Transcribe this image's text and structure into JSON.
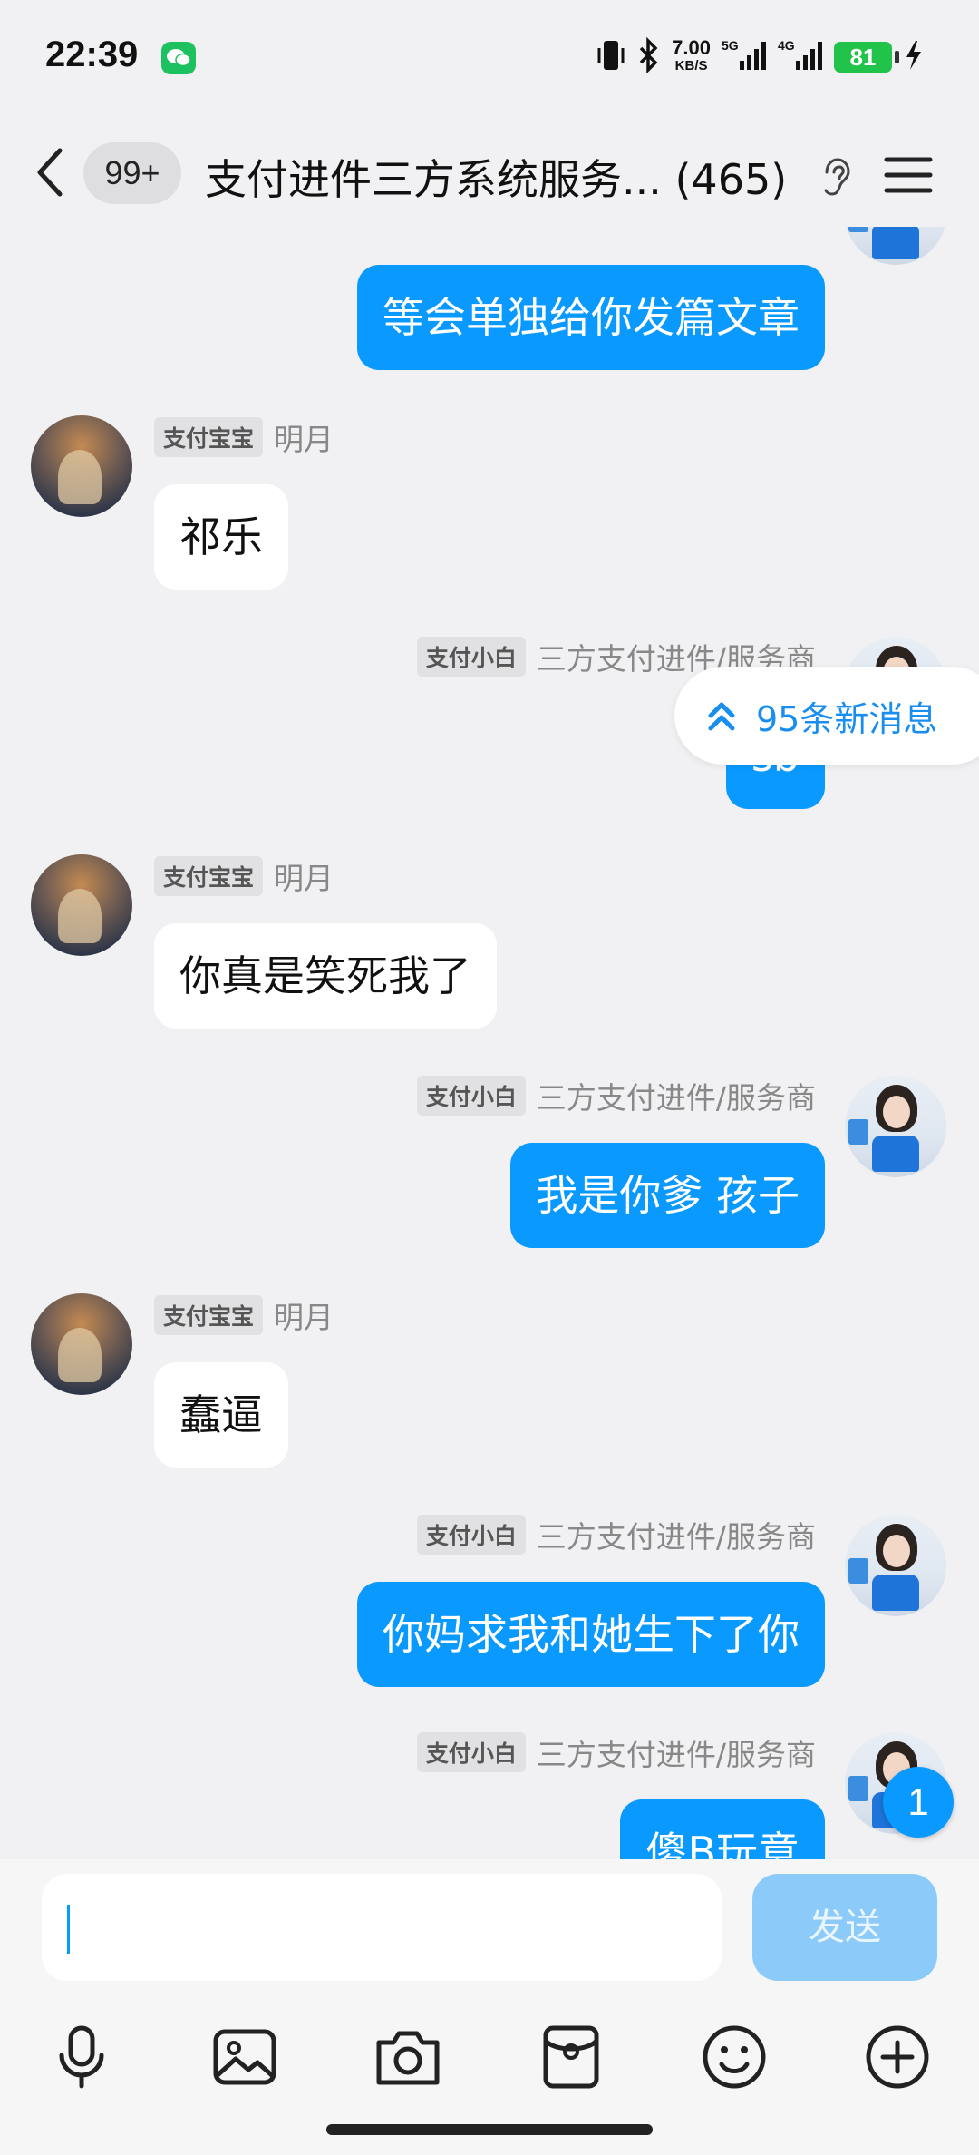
{
  "status_bar": {
    "time": "22:39",
    "speed_value": "7.00",
    "speed_unit": "KB/S",
    "net_1": "5G",
    "net_2": "4G",
    "battery": "81"
  },
  "header": {
    "unread_count": "99+",
    "title": "支付进件三方系统服务... (465)"
  },
  "new_messages_label": "95条新消息",
  "messages": [
    {
      "side": "right",
      "text": "等会单独给你发篇文章"
    },
    {
      "side": "left",
      "tag": "支付宝宝",
      "nick": "明月",
      "text": "祁乐"
    },
    {
      "side": "right",
      "tag": "支付小白",
      "nick": "三方支付进件/服务商",
      "text": "sb"
    },
    {
      "side": "left",
      "tag": "支付宝宝",
      "nick": "明月",
      "text": "你真是笑死我了"
    },
    {
      "side": "right",
      "tag": "支付小白",
      "nick": "三方支付进件/服务商",
      "text": "我是你爹 孩子"
    },
    {
      "side": "left",
      "tag": "支付宝宝",
      "nick": "明月",
      "text": "蠢逼"
    },
    {
      "side": "right",
      "tag": "支付小白",
      "nick": "三方支付进件/服务商",
      "text": "你妈求我和她生下了你"
    },
    {
      "side": "right",
      "tag": "支付小白",
      "nick": "三方支付进件/服务商",
      "text": "傻B玩意"
    }
  ],
  "unread_badge": "1",
  "input": {
    "placeholder": "",
    "send_label": "发送"
  },
  "toolbar_icons": [
    "microphone-icon",
    "image-icon",
    "camera-icon",
    "red-packet-icon",
    "emoji-icon",
    "plus-icon"
  ],
  "colors": {
    "accent": "#0a99ff",
    "send_disabled": "#8ccbf9",
    "background": "#f1f1f3"
  }
}
